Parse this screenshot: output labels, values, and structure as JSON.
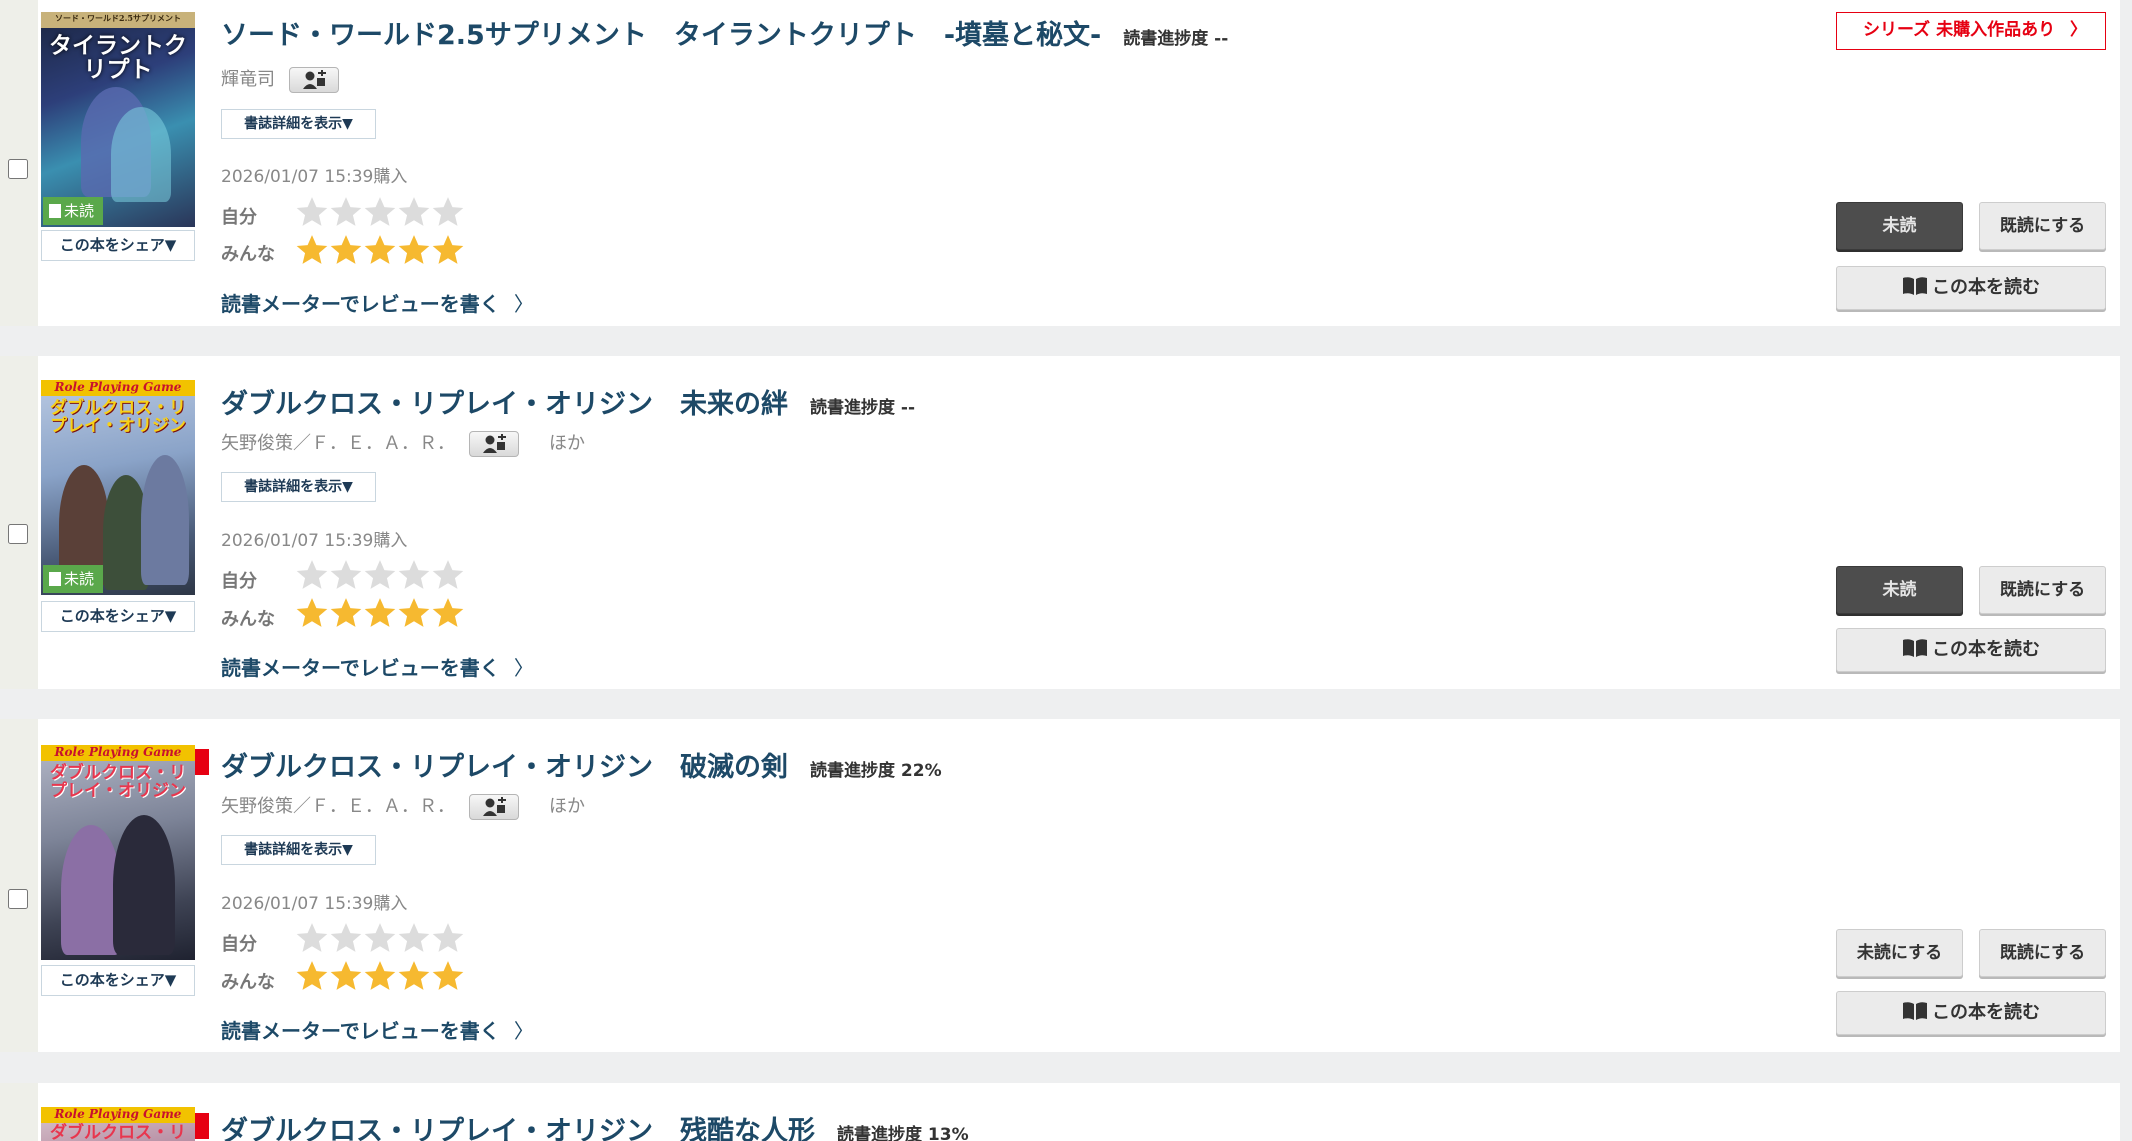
{
  "colors": {
    "accent_red": "#e60012",
    "title_blue": "#1d4967",
    "star_filled": "#f6b930",
    "star_empty": "#dcdcdc",
    "unread_badge": "#5aa84b"
  },
  "labels": {
    "share": "この本をシェア▼",
    "detail": "書誌詳細を表示▼",
    "self_rating": "自分",
    "everyone_rating": "みんな",
    "review": "読書メーターでレビューを書く",
    "read_book": "この本を読む",
    "mark_read": "既読にする",
    "unread_badge": "未読",
    "progress_prefix": "読書進捗度",
    "series_unpurchased": "シリーズ 未購入作品あり"
  },
  "books": [
    {
      "title": "ソード・ワールド2.5サプリメント　タイラントクリプト　-墳墓と秘文-",
      "progress": "読書進捗度 --",
      "author": "輝竜司",
      "author_extra": "",
      "purchase_date": "2026/01/07 15:39購入",
      "self_stars": 0,
      "everyone_stars": 5,
      "status_label": "未読",
      "status_active": true,
      "unread_badge": true,
      "has_series_link": true,
      "cover": {
        "top_text": "ソード・ワールド2.5サプリメント",
        "title_text": "タイラントクリプト"
      }
    },
    {
      "title": "ダブルクロス・リプレイ・オリジン　未来の絆",
      "progress": "読書進捗度 --",
      "author": "矢野俊策／Ｆ．Ｅ．Ａ．Ｒ．",
      "author_extra": "ほか",
      "purchase_date": "2026/01/07 15:39購入",
      "self_stars": 0,
      "everyone_stars": 5,
      "status_label": "未読",
      "status_active": true,
      "unread_badge": true,
      "has_series_link": false,
      "cover": {
        "top_text": "Role Playing Game",
        "title_text": "ダブルクロス・リプレイ・オリジン"
      }
    },
    {
      "title": "ダブルクロス・リプレイ・オリジン　破滅の剣",
      "progress": "読書進捗度 22%",
      "author": "矢野俊策／Ｆ．Ｅ．Ａ．Ｒ．",
      "author_extra": "ほか",
      "purchase_date": "2026/01/07 15:39購入",
      "self_stars": 0,
      "everyone_stars": 5,
      "status_label": "未読にする",
      "status_active": false,
      "unread_badge": false,
      "has_series_link": false,
      "cover": {
        "top_text": "Role Playing Game",
        "title_text": "ダブルクロス・リプレイ・オリジン"
      }
    },
    {
      "title": "ダブルクロス・リプレイ・オリジン　残酷な人形",
      "progress": "読書進捗度 13%",
      "author": "",
      "author_extra": "",
      "purchase_date": "",
      "self_stars": 0,
      "everyone_stars": 0,
      "status_label": "",
      "status_active": false,
      "unread_badge": false,
      "has_series_link": false,
      "cover": {
        "top_text": "Role Playing Game",
        "title_text": "ダブルクロス・リプレイ・オ"
      }
    }
  ]
}
